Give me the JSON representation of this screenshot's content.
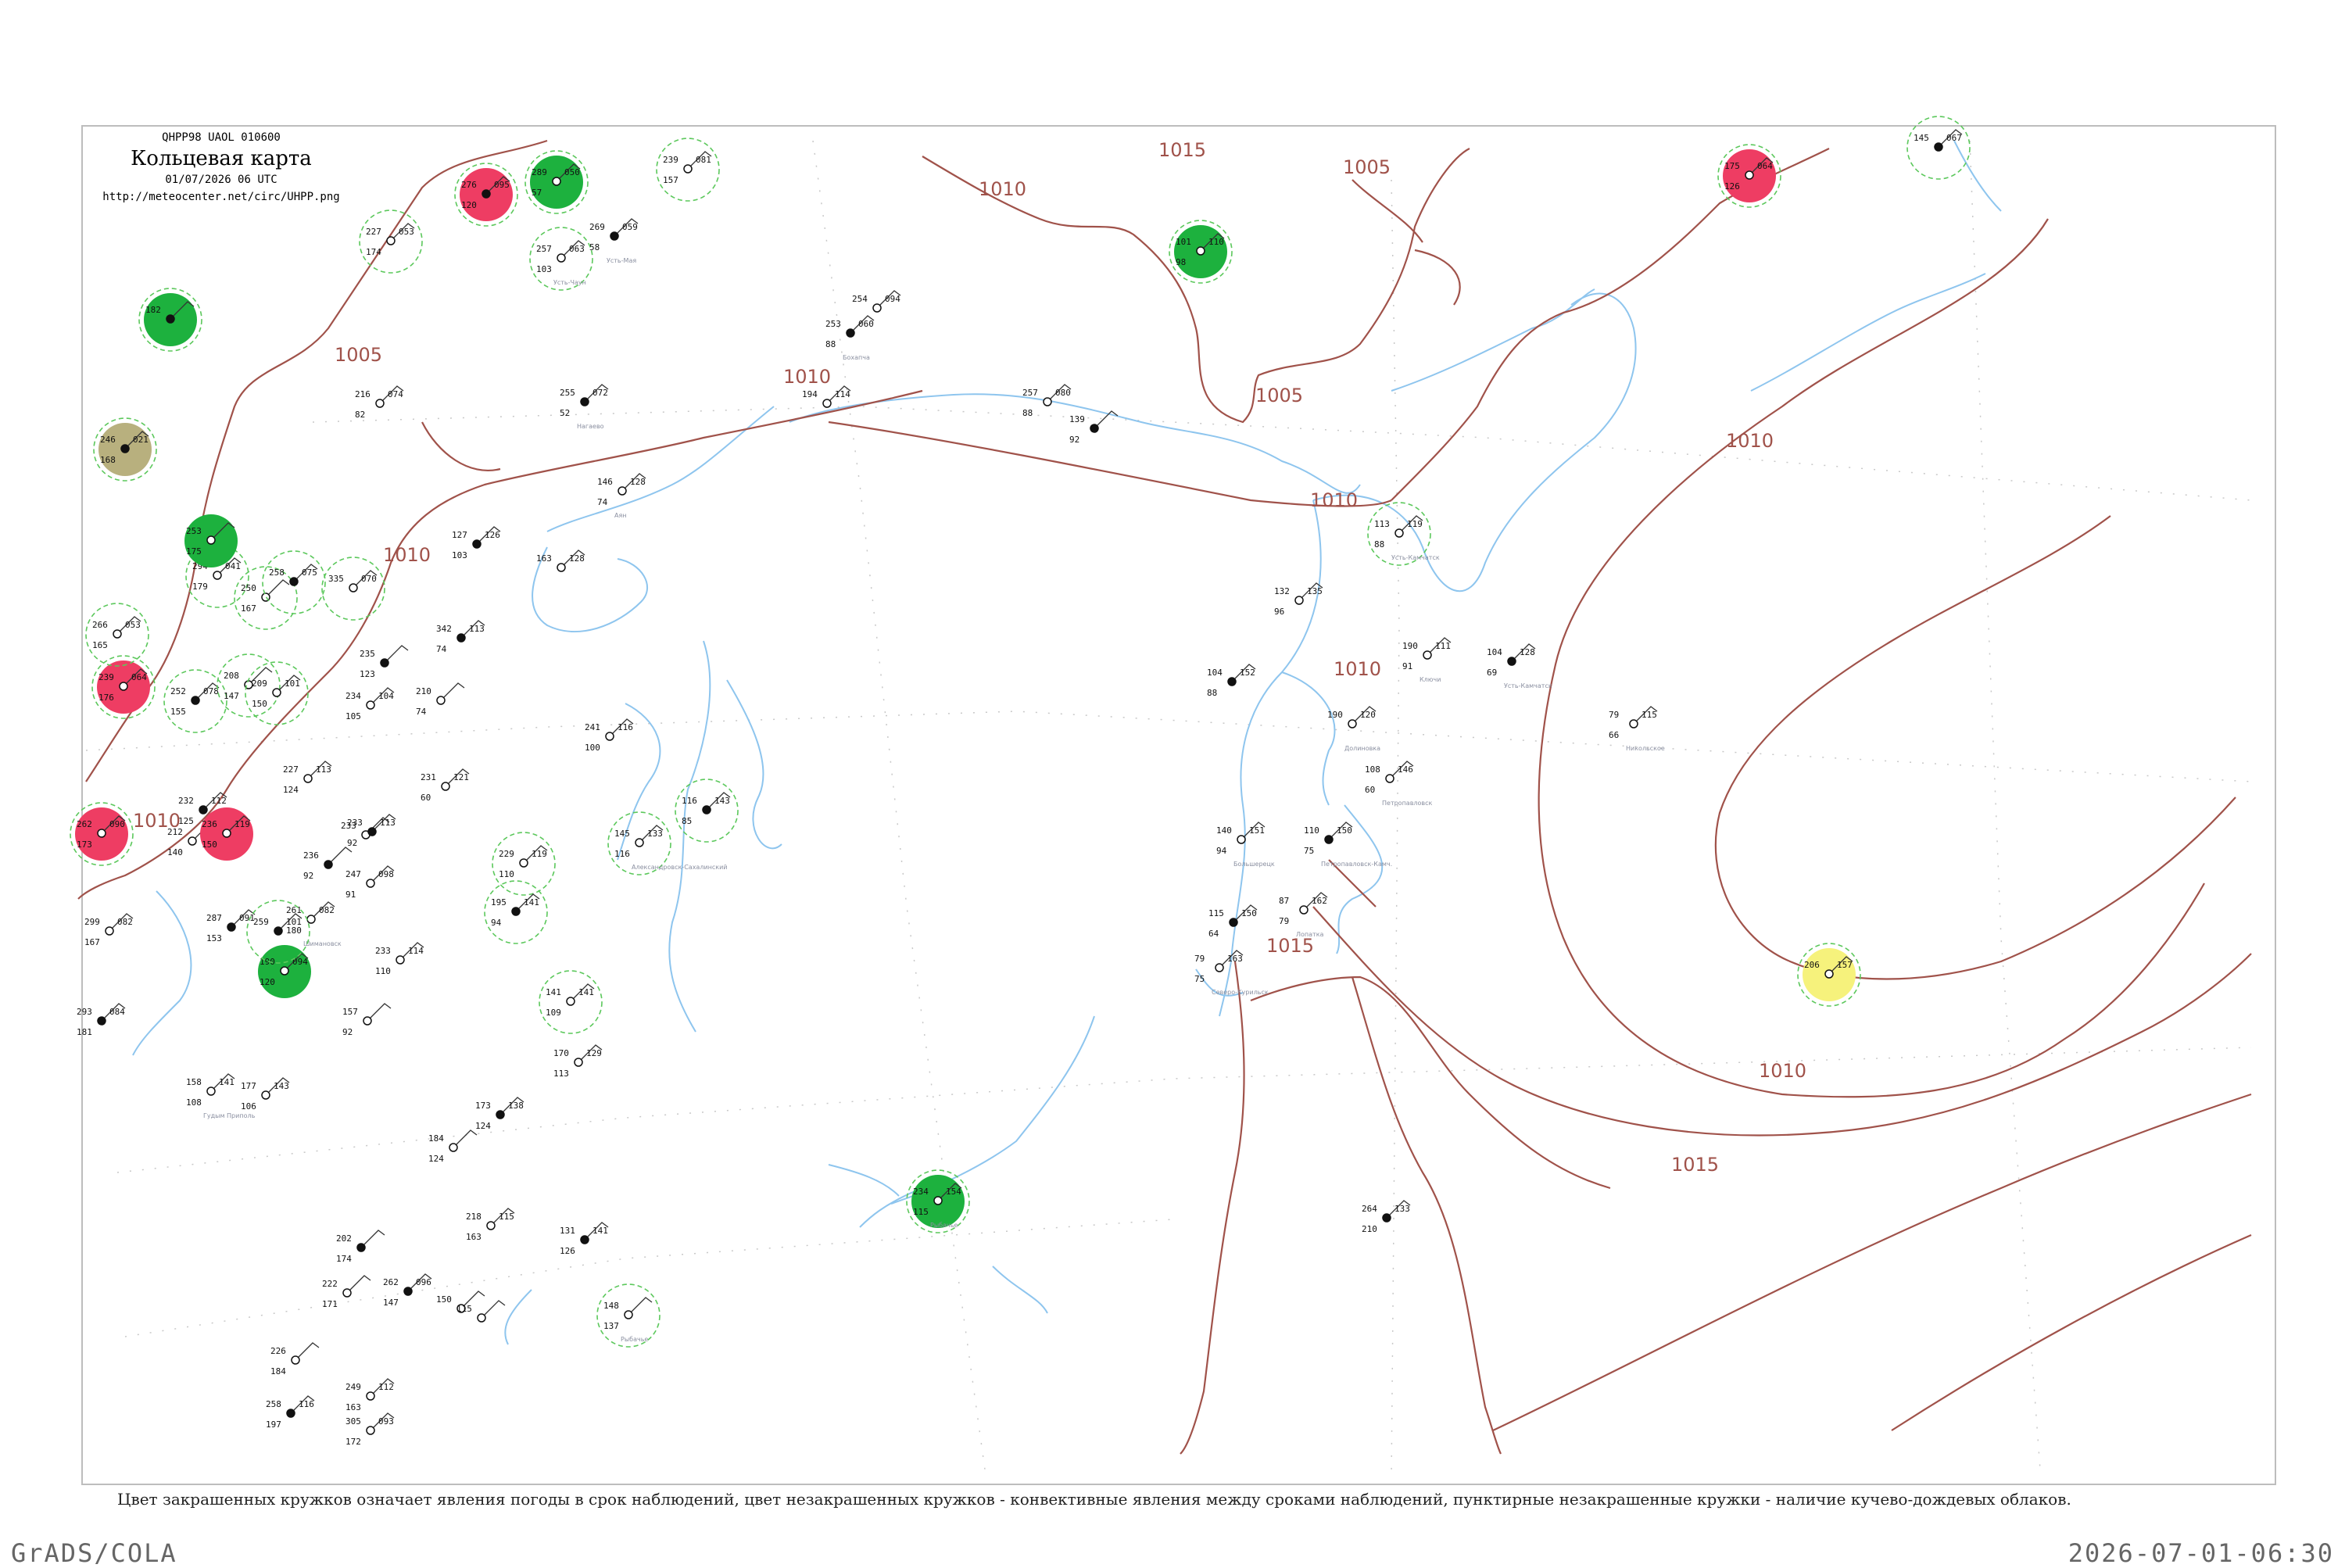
{
  "header": {
    "code": "QHPP98  UAOL  010600",
    "title": "Кольцевая карта",
    "datetime": "01/07/2026 06 UTC",
    "url": "http://meteocenter.net/circ/UHPP.png"
  },
  "legend_note": "Цвет закрашенных кружков означает явления погоды в срок наблюдений, цвет незакрашенных кружков - конвективные явления между сроками наблюдений, пунктирные незакрашенные кружки - наличие кучево-дождевых облаков.",
  "footer": {
    "left": "GrADS/COLA",
    "right": "2026-07-01-06:30"
  },
  "colors": {
    "isobar": "#a0524a",
    "coast": "#8ec5ee",
    "storm_red": "#ee3d63",
    "rain_green": "#1db13e",
    "fog_olive": "#b8b07e",
    "haze_yellow": "#f6f27c",
    "cb_dashed": "#5cc85c"
  },
  "isobar_labels": [
    "1015",
    "1010",
    "1005",
    "1005",
    "1010",
    "1010",
    "1010",
    "1005",
    "1010",
    "1010",
    "1015",
    "1010",
    "1015",
    "1010"
  ],
  "stations": [
    {
      "n": "246",
      "p": "021",
      "d": "168",
      "name": ""
    },
    {
      "n": "239",
      "p": "064",
      "d": "176",
      "name": ""
    },
    {
      "n": "266",
      "p": "053",
      "d": "165",
      "name": ""
    },
    {
      "n": "252",
      "p": "078",
      "d": "155",
      "name": ""
    },
    {
      "n": "262",
      "p": "090",
      "d": "173",
      "name": ""
    },
    {
      "n": "299",
      "p": "082",
      "d": "167",
      "name": ""
    },
    {
      "n": "293",
      "p": "084",
      "d": "181",
      "name": ""
    },
    {
      "n": "158",
      "p": "141",
      "d": "108",
      "name": "Гудым Приполь"
    },
    {
      "n": "177",
      "p": "143",
      "d": "106",
      "name": ""
    },
    {
      "n": "182",
      "p": "",
      "d": "",
      "name": ""
    },
    {
      "n": "294",
      "p": "041",
      "d": "179",
      "name": ""
    },
    {
      "n": "250",
      "p": "",
      "d": "167",
      "name": ""
    },
    {
      "n": "276",
      "p": "095",
      "d": "120",
      "name": ""
    },
    {
      "n": "289",
      "p": "050",
      "d": "57",
      "name": ""
    },
    {
      "n": "257",
      "p": "063",
      "d": "103",
      "name": "Усть-Чаун"
    },
    {
      "n": "269",
      "p": "059",
      "d": "58",
      "name": "Усть-Мая"
    },
    {
      "n": "227",
      "p": "053",
      "d": "174",
      "name": ""
    },
    {
      "n": "216",
      "p": "074",
      "d": "82",
      "name": ""
    },
    {
      "n": "255",
      "p": "072",
      "d": "52",
      "name": "Нагаево"
    },
    {
      "n": "239",
      "p": "081",
      "d": "157",
      "name": ""
    },
    {
      "n": "254",
      "p": "094",
      "d": "",
      "name": ""
    },
    {
      "n": "253",
      "p": "060",
      "d": "88",
      "name": "Бохапча"
    },
    {
      "n": "194",
      "p": "114",
      "d": "",
      "name": ""
    },
    {
      "n": "146",
      "p": "128",
      "d": "74",
      "name": "Аян"
    },
    {
      "n": "127",
      "p": "126",
      "d": "103",
      "name": ""
    },
    {
      "n": "163",
      "p": "128",
      "d": "",
      "name": ""
    },
    {
      "n": "257",
      "p": "080",
      "d": "88",
      "name": ""
    },
    {
      "n": "139",
      "p": "",
      "d": "92",
      "name": ""
    },
    {
      "n": "101",
      "p": "110",
      "d": "98",
      "name": ""
    },
    {
      "n": "175",
      "p": "064",
      "d": "126",
      "name": ""
    },
    {
      "n": "145",
      "p": "067",
      "d": "",
      "name": ""
    },
    {
      "n": "113",
      "p": "119",
      "d": "88",
      "name": "Усть-Камчатск"
    },
    {
      "n": "132",
      "p": "135",
      "d": "96",
      "name": ""
    },
    {
      "n": "104",
      "p": "152",
      "d": "88",
      "name": ""
    },
    {
      "n": "190",
      "p": "120",
      "d": "",
      "name": "Долиновка"
    },
    {
      "n": "190",
      "p": "111",
      "d": "91",
      "name": "Ключи"
    },
    {
      "n": "104",
      "p": "128",
      "d": "69",
      "name": "Усть-Камчатск"
    },
    {
      "n": "79",
      "p": "115",
      "d": "66",
      "name": "Никольское"
    },
    {
      "n": "108",
      "p": "146",
      "d": "60",
      "name": "Петропавловск"
    },
    {
      "n": "110",
      "p": "150",
      "d": "75",
      "name": "Петропавловск-Камч."
    },
    {
      "n": "140",
      "p": "151",
      "d": "94",
      "name": "Большерецк"
    },
    {
      "n": "87",
      "p": "162",
      "d": "79",
      "name": "Лопатка"
    },
    {
      "n": "115",
      "p": "150",
      "d": "64",
      "name": ""
    },
    {
      "n": "79",
      "p": "163",
      "d": "75",
      "name": "Северо-Курильск"
    },
    {
      "n": "206",
      "p": "157",
      "d": "",
      "name": ""
    },
    {
      "n": "342",
      "p": "113",
      "d": "74",
      "name": ""
    },
    {
      "n": "231",
      "p": "121",
      "d": "60",
      "name": ""
    },
    {
      "n": "241",
      "p": "116",
      "d": "100",
      "name": ""
    },
    {
      "n": "116",
      "p": "143",
      "d": "85",
      "name": ""
    },
    {
      "n": "145",
      "p": "133",
      "d": "116",
      "name": "Александровск-Сахалинский"
    },
    {
      "n": "229",
      "p": "119",
      "d": "110",
      "name": ""
    },
    {
      "n": "195",
      "p": "141",
      "d": "94",
      "name": ""
    },
    {
      "n": "141",
      "p": "141",
      "d": "109",
      "name": ""
    },
    {
      "n": "170",
      "p": "129",
      "d": "113",
      "name": ""
    },
    {
      "n": "173",
      "p": "138",
      "d": "124",
      "name": ""
    },
    {
      "n": "184",
      "p": "",
      "d": "124",
      "name": ""
    },
    {
      "n": "218",
      "p": "115",
      "d": "163",
      "name": ""
    },
    {
      "n": "131",
      "p": "141",
      "d": "126",
      "name": ""
    },
    {
      "n": "148",
      "p": "",
      "d": "137",
      "name": "Рыбачье"
    },
    {
      "n": "234",
      "p": "154",
      "d": "115",
      "name": "Рыбачье"
    },
    {
      "n": "264",
      "p": "133",
      "d": "210",
      "name": ""
    },
    {
      "n": "233",
      "p": "114",
      "d": "110",
      "name": ""
    },
    {
      "n": "157",
      "p": "",
      "d": "92",
      "name": ""
    },
    {
      "n": "202",
      "p": "",
      "d": "174",
      "name": ""
    },
    {
      "n": "222",
      "p": "",
      "d": "171",
      "name": ""
    },
    {
      "n": "226",
      "p": "",
      "d": "184",
      "name": ""
    },
    {
      "n": "258",
      "p": "116",
      "d": "197",
      "name": ""
    },
    {
      "n": "305",
      "p": "093",
      "d": "172",
      "name": ""
    },
    {
      "n": "249",
      "p": "112",
      "d": "163",
      "name": ""
    },
    {
      "n": "262",
      "p": "096",
      "d": "147",
      "name": ""
    },
    {
      "n": "150",
      "p": "",
      "d": "",
      "name": ""
    },
    {
      "n": "115",
      "p": "",
      "d": "",
      "name": ""
    },
    {
      "n": "236",
      "p": "",
      "d": "92",
      "name": ""
    },
    {
      "n": "233",
      "p": "",
      "d": "",
      "name": ""
    },
    {
      "n": "261",
      "p": "082",
      "d": "180",
      "name": "Шимановск"
    },
    {
      "n": "287",
      "p": "091",
      "d": "153",
      "name": ""
    },
    {
      "n": "190",
      "p": "094",
      "d": "120",
      "name": ""
    },
    {
      "n": "234",
      "p": "104",
      "d": "105",
      "name": ""
    },
    {
      "n": "233",
      "p": "113",
      "d": "92",
      "name": ""
    },
    {
      "n": "247",
      "p": "098",
      "d": "91",
      "name": ""
    },
    {
      "n": "227",
      "p": "113",
      "d": "124",
      "name": ""
    },
    {
      "n": "232",
      "p": "112",
      "d": "125",
      "name": ""
    },
    {
      "n": "212",
      "p": "106",
      "d": "140",
      "name": ""
    },
    {
      "n": "236",
      "p": "119",
      "d": "150",
      "name": ""
    },
    {
      "n": "259",
      "p": "101",
      "d": "",
      "name": ""
    },
    {
      "n": "253",
      "p": "",
      "d": "175",
      "name": ""
    },
    {
      "n": "335",
      "p": "070",
      "d": "",
      "name": ""
    },
    {
      "n": "258",
      "p": "075",
      "d": "",
      "name": ""
    },
    {
      "n": "208",
      "p": "",
      "d": "147",
      "name": ""
    },
    {
      "n": "209",
      "p": "101",
      "d": "150",
      "name": ""
    },
    {
      "n": "235",
      "p": "",
      "d": "123",
      "name": ""
    },
    {
      "n": "210",
      "p": "",
      "d": "74",
      "name": ""
    }
  ]
}
